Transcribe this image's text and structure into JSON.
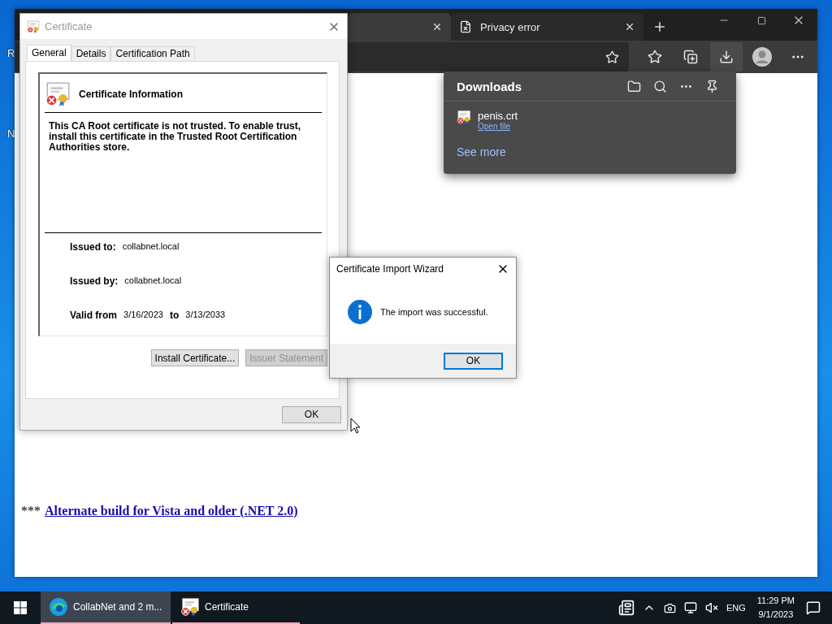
{
  "desktop": {
    "icon_labels": [
      "R",
      "N"
    ]
  },
  "browser": {
    "tabs": [
      {
        "selected": true
      },
      {
        "title": "Privacy error",
        "selected": false
      }
    ],
    "page": {
      "prefix": "***",
      "link": "Alternate build for Vista and older (.NET 2.0)"
    }
  },
  "downloads": {
    "title": "Downloads",
    "items": [
      {
        "name": "penis.crt",
        "action": "Open file"
      }
    ],
    "see_more": "See more"
  },
  "certificate_dialog": {
    "title": "Certificate",
    "active": false,
    "tabs": [
      {
        "label": "General",
        "selected": true
      },
      {
        "label": "Details",
        "selected": false
      },
      {
        "label": "Certification Path",
        "selected": false
      }
    ],
    "heading": "Certificate Information",
    "message": "This CA Root certificate is not trusted. To enable trust, install this certificate in the Trusted Root Certification Authorities store.",
    "fields": [
      {
        "label": "Issued to:",
        "value": "collabnet.local"
      },
      {
        "label": "Issued by:",
        "value": "collabnet.local"
      }
    ],
    "validity": {
      "label": "Valid from",
      "from": "3/16/2023",
      "to_label": "to",
      "to": "3/13/2033"
    },
    "buttons": [
      {
        "label": "Install Certificate...",
        "disabled": false
      },
      {
        "label": "Issuer Statement",
        "disabled": true
      }
    ],
    "ok": "OK"
  },
  "wizard": {
    "title": "Certificate Import Wizard",
    "message": "The import was successful.",
    "ok": "OK"
  },
  "taskbar": {
    "items": [
      {
        "kind": "edge",
        "label": "CollabNet and 2 m...",
        "selected": true
      },
      {
        "kind": "certificate",
        "label": "Certificate",
        "selected": false
      }
    ],
    "language": "ENG",
    "time": "11:29 PM",
    "date": "9/1/2023"
  }
}
